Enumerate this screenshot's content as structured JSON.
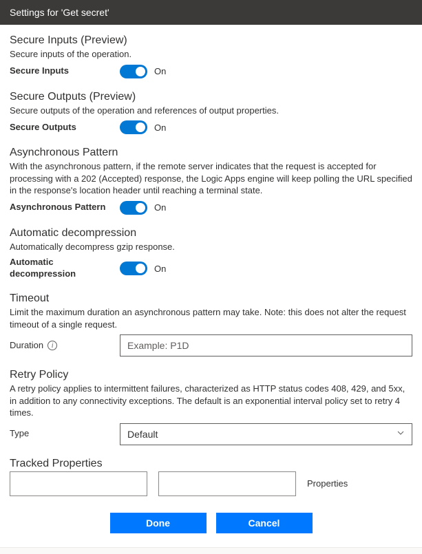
{
  "titlebar": "Settings for 'Get secret'",
  "sections": {
    "secureInputs": {
      "title": "Secure Inputs (Preview)",
      "desc": "Secure inputs of the operation.",
      "label": "Secure Inputs",
      "state": "On"
    },
    "secureOutputs": {
      "title": "Secure Outputs (Preview)",
      "desc": "Secure outputs of the operation and references of output properties.",
      "label": "Secure Outputs",
      "state": "On"
    },
    "asyncPattern": {
      "title": "Asynchronous Pattern",
      "desc": "With the asynchronous pattern, if the remote server indicates that the request is accepted for processing with a 202 (Accepted) response, the Logic Apps engine will keep polling the URL specified in the response's location header until reaching a terminal state.",
      "label": "Asynchronous Pattern",
      "state": "On"
    },
    "autoDecomp": {
      "title": "Automatic decompression",
      "desc": "Automatically decompress gzip response.",
      "label": "Automatic decompression",
      "state": "On"
    },
    "timeout": {
      "title": "Timeout",
      "desc": "Limit the maximum duration an asynchronous pattern may take. Note: this does not alter the request timeout of a single request.",
      "label": "Duration",
      "placeholder": "Example: P1D"
    },
    "retry": {
      "title": "Retry Policy",
      "desc": "A retry policy applies to intermittent failures, characterized as HTTP status codes 408, 429, and 5xx, in addition to any connectivity exceptions. The default is an exponential interval policy set to retry 4 times.",
      "label": "Type",
      "value": "Default"
    },
    "tracked": {
      "title": "Tracked Properties",
      "propLabel": "Properties"
    }
  },
  "buttons": {
    "done": "Done",
    "cancel": "Cancel"
  }
}
